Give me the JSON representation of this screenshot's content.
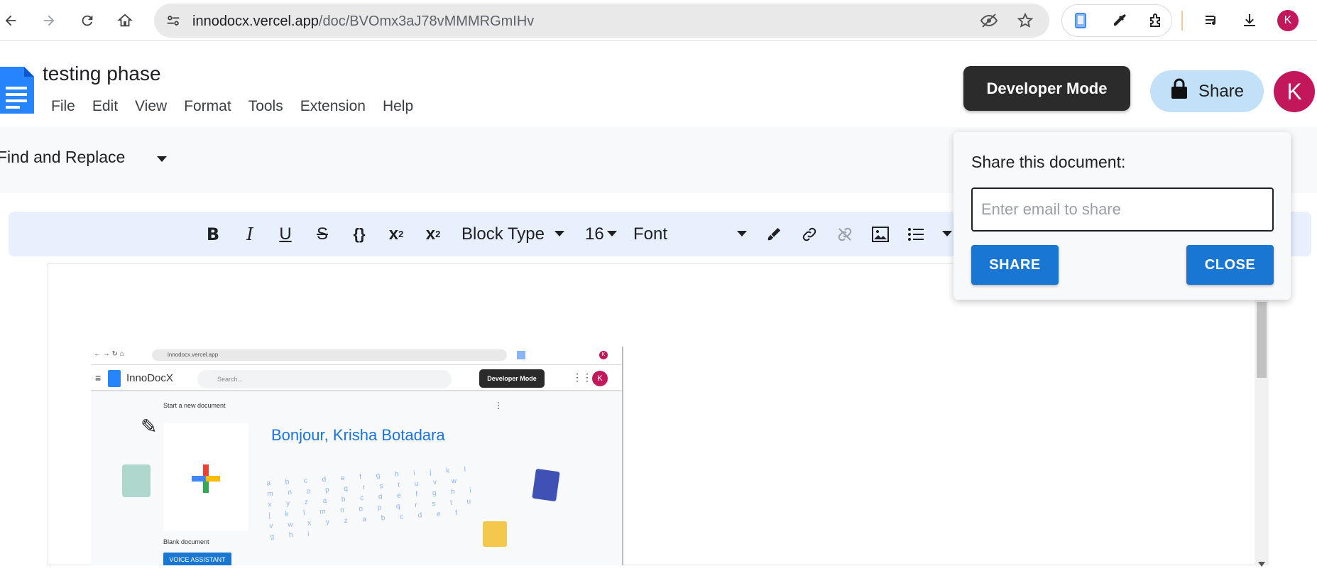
{
  "browser": {
    "url_host": "innodocx.vercel.app",
    "url_path": "/doc/BVOmx3aJ78vMMMRGmIHv",
    "avatar_letter": "K",
    "icons": [
      "back-icon",
      "forward-icon",
      "reload-icon",
      "home-icon",
      "site-settings-icon",
      "eye-off-icon",
      "star-icon",
      "phone-icon",
      "eyedropper-icon",
      "extensions-icon",
      "media-icon",
      "download-icon"
    ]
  },
  "doc": {
    "title": "testing phase",
    "menu": [
      "File",
      "Edit",
      "View",
      "Format",
      "Tools",
      "Extension",
      "Help"
    ]
  },
  "header": {
    "developer_mode": "Developer Mode",
    "share_label": "Share",
    "avatar_letter": "K"
  },
  "findbar": {
    "label": "Find and Replace"
  },
  "toolbar": {
    "block_type": "Block Type",
    "font_size": "16",
    "font": "Font",
    "icons": [
      "bold-icon",
      "italic-icon",
      "underline-icon",
      "strikethrough-icon",
      "code-icon",
      "superscript-icon",
      "subscript-icon",
      "brush-icon",
      "link-icon",
      "unlink-icon",
      "image-icon",
      "list-icon"
    ]
  },
  "embedded": {
    "url": "innodocx.vercel.app",
    "app_name": "InnoDocX",
    "search_placeholder": "Search...",
    "developer_mode": "Developer Mode",
    "avatar_letter": "K",
    "start_new": "Start a new document",
    "greeting": "Bonjour, Krisha Botadara",
    "blank_doc": "Blank document",
    "voice_assistant": "VOICE ASSISTANT"
  },
  "share_popup": {
    "title": "Share this document:",
    "email_placeholder": "Enter email to share",
    "email_value": "",
    "share_button": "SHARE",
    "close_button": "CLOSE"
  },
  "colors": {
    "accent": "#1976d2",
    "avatar": "#c2185b",
    "share_pill": "#c2e0f7",
    "toolbar_bg": "#e8f0fe",
    "dev_mode_bg": "#2b2b2b"
  }
}
